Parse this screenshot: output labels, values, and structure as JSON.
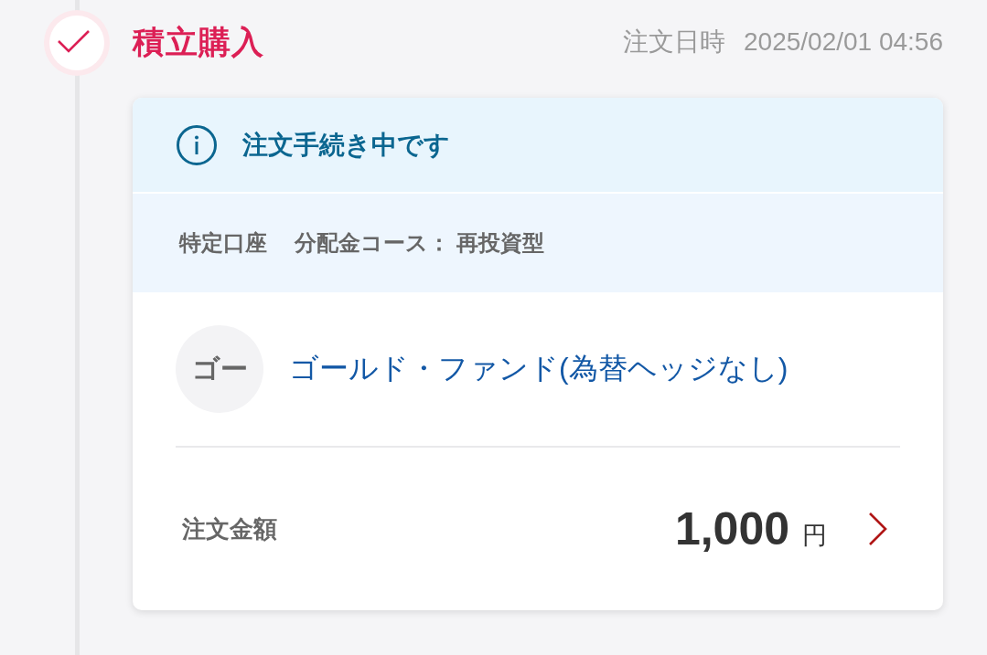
{
  "order": {
    "type_label": "積立購入",
    "date_label": "注文日時",
    "date_value": "2025/02/01 04:56",
    "status_message": "注文手続き中です",
    "account_type": "特定口座",
    "distribution_course": "分配金コース： 再投資型",
    "fund": {
      "avatar": "ゴー",
      "name": "ゴールド・ファンド(為替ヘッジなし)"
    },
    "amount": {
      "label": "注文金額",
      "value": "1,000",
      "unit": "円"
    }
  }
}
